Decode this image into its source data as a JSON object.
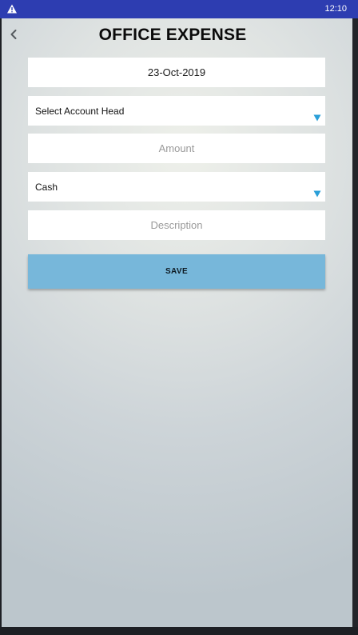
{
  "status_bar": {
    "time": "12:10",
    "warning_icon": "warning-triangle-icon",
    "background": "#2d3db1"
  },
  "header": {
    "back_icon": "chevron-left-icon",
    "title": "OFFICE EXPENSE"
  },
  "form": {
    "date_value": "23-Oct-2019",
    "account_head_value": "Select Account Head",
    "amount_placeholder": "Amount",
    "payment_mode_value": "Cash",
    "description_placeholder": "Description",
    "dropdown_icon": "triangle-down-icon",
    "dropdown_icon_color": "#2a9fd8"
  },
  "actions": {
    "save_label": "SAVE",
    "save_color": "#77b7da"
  }
}
